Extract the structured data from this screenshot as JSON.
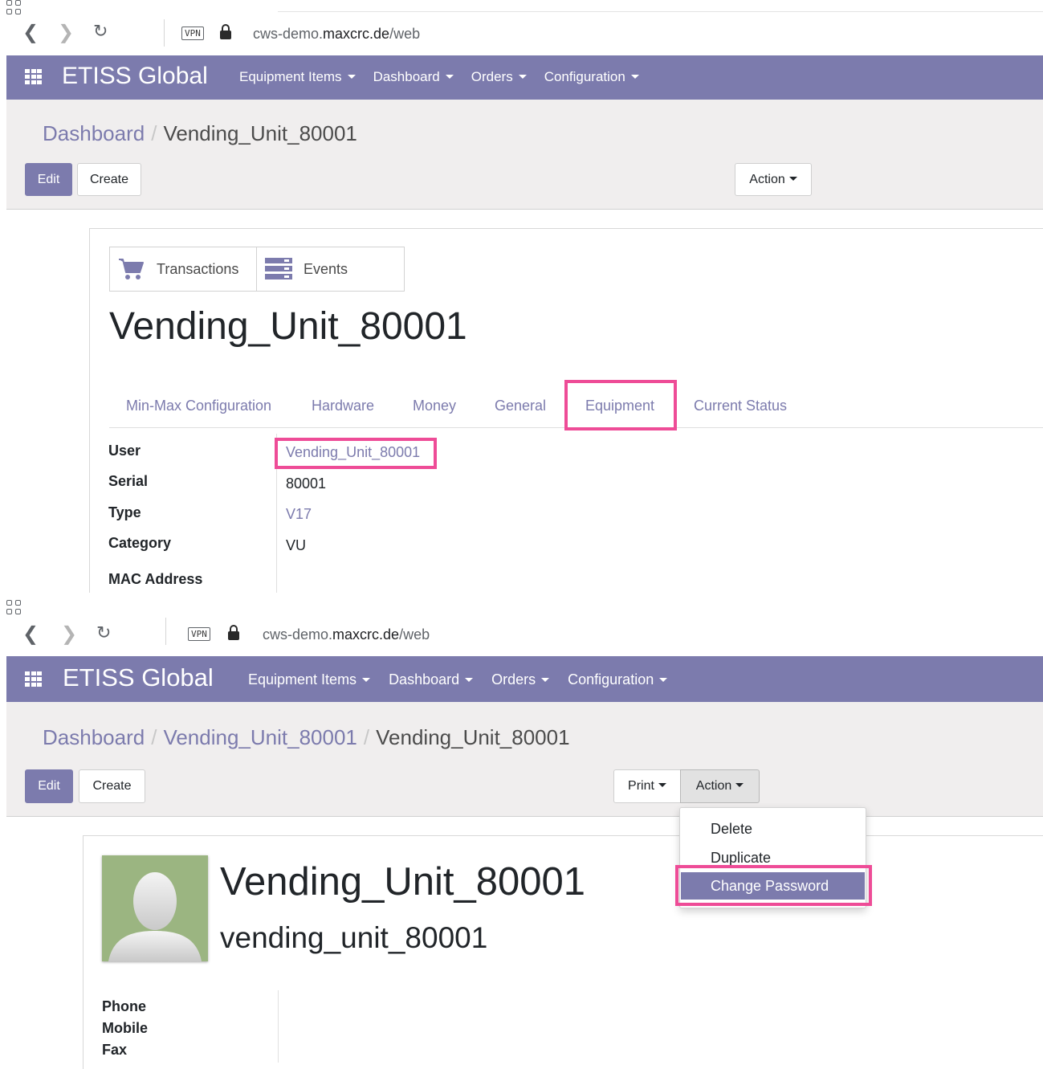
{
  "browser": {
    "url_prefix": "cws-demo.",
    "url_host": "maxcrc.de",
    "url_path": "/web",
    "vpn_label": "VPN"
  },
  "navbar": {
    "brand": "ETISS Global",
    "menu": [
      "Equipment Items",
      "Dashboard",
      "Orders",
      "Configuration"
    ]
  },
  "screen1": {
    "breadcrumb": {
      "parent": "Dashboard",
      "current": "Vending_Unit_80001"
    },
    "buttons": {
      "edit": "Edit",
      "create": "Create",
      "action": "Action"
    },
    "smart_buttons": {
      "transactions": "Transactions",
      "events": "Events"
    },
    "title": "Vending_Unit_80001",
    "tabs": [
      "Min-Max Configuration",
      "Hardware",
      "Money",
      "General",
      "Equipment",
      "Current Status"
    ],
    "active_tab": "Equipment",
    "fields": {
      "user_label": "User",
      "user_value": "Vending_Unit_80001",
      "serial_label": "Serial",
      "serial_value": "80001",
      "type_label": "Type",
      "type_value": "V17",
      "category_label": "Category",
      "category_value": "VU",
      "mac_label": "MAC Address"
    }
  },
  "screen2": {
    "breadcrumb": {
      "root": "Dashboard",
      "parent": "Vending_Unit_80001",
      "current": "Vending_Unit_80001"
    },
    "buttons": {
      "edit": "Edit",
      "create": "Create",
      "print": "Print",
      "action": "Action"
    },
    "action_menu": [
      "Delete",
      "Duplicate",
      "Change Password"
    ],
    "active_menu_item": "Change Password",
    "title": "Vending_Unit_80001",
    "login": "vending_unit_80001",
    "fields": {
      "phone_label": "Phone",
      "mobile_label": "Mobile",
      "fax_label": "Fax"
    }
  },
  "colors": {
    "brand": "#7c7bad",
    "highlight": "#ee4c97",
    "control_panel_bg": "#f0eeee",
    "avatar_bg": "#9bb581"
  },
  "icons": [
    "back-icon",
    "forward-icon",
    "reload-icon",
    "apps-icon",
    "lock-icon",
    "cart-icon",
    "events-icon",
    "app-grid-icon",
    "caret-down-icon",
    "avatar-placeholder-icon"
  ]
}
